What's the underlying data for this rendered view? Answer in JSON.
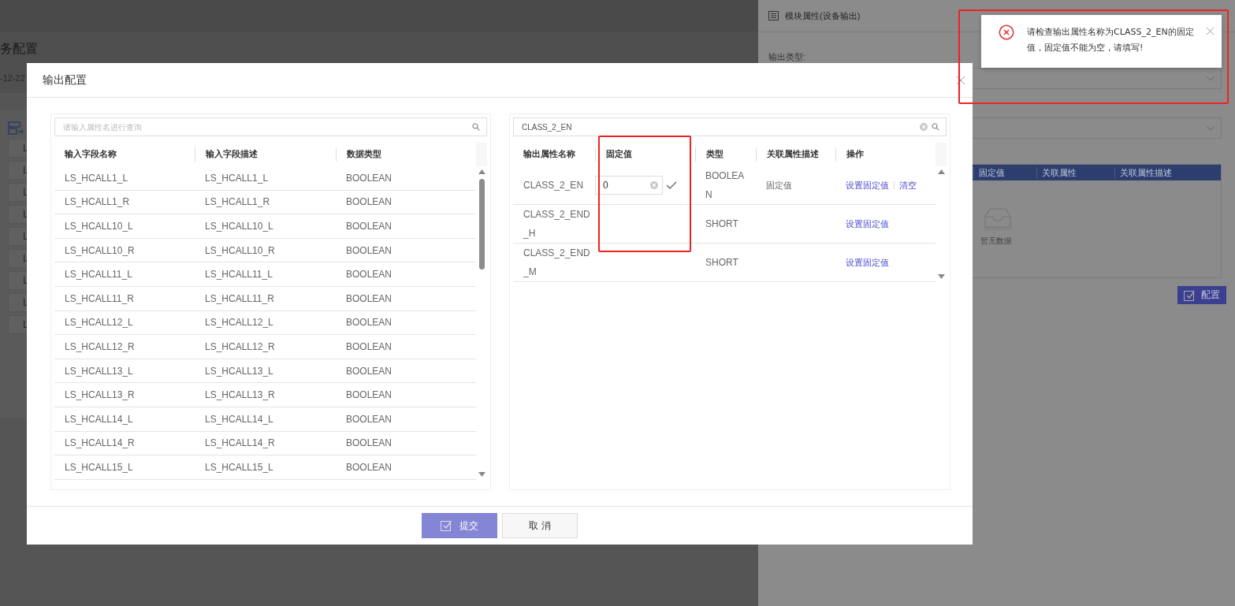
{
  "background_page": {
    "title": "务配置",
    "date": "-12-22",
    "list_items": [
      "L",
      "L",
      "L",
      "L",
      "L",
      "L",
      "L",
      "L",
      "L"
    ]
  },
  "side_panel": {
    "title": "模块属性(设备输出)",
    "output_type_label": "输出类型:",
    "table_columns": [
      "固定值",
      "关联属性",
      "关联属性描述"
    ],
    "empty_text": "暂无数据",
    "configure_button": "配置"
  },
  "dialog": {
    "title": "输出配置",
    "left": {
      "search_placeholder": "请输入属性名进行查询",
      "columns": [
        "输入字段名称",
        "输入字段描述",
        "数据类型"
      ],
      "rows": [
        [
          "LS_HCALL1_L",
          "LS_HCALL1_L",
          "BOOLEAN"
        ],
        [
          "LS_HCALL1_R",
          "LS_HCALL1_R",
          "BOOLEAN"
        ],
        [
          "LS_HCALL10_L",
          "LS_HCALL10_L",
          "BOOLEAN"
        ],
        [
          "LS_HCALL10_R",
          "LS_HCALL10_R",
          "BOOLEAN"
        ],
        [
          "LS_HCALL11_L",
          "LS_HCALL11_L",
          "BOOLEAN"
        ],
        [
          "LS_HCALL11_R",
          "LS_HCALL11_R",
          "BOOLEAN"
        ],
        [
          "LS_HCALL12_L",
          "LS_HCALL12_L",
          "BOOLEAN"
        ],
        [
          "LS_HCALL12_R",
          "LS_HCALL12_R",
          "BOOLEAN"
        ],
        [
          "LS_HCALL13_L",
          "LS_HCALL13_L",
          "BOOLEAN"
        ],
        [
          "LS_HCALL13_R",
          "LS_HCALL13_R",
          "BOOLEAN"
        ],
        [
          "LS_HCALL14_L",
          "LS_HCALL14_L",
          "BOOLEAN"
        ],
        [
          "LS_HCALL14_R",
          "LS_HCALL14_R",
          "BOOLEAN"
        ],
        [
          "LS_HCALL15_L",
          "LS_HCALL15_L",
          "BOOLEAN"
        ]
      ]
    },
    "right": {
      "search_value": "CLASS_2_EN",
      "columns": [
        "输出属性名称",
        "固定值",
        "类型",
        "关联属性描述",
        "操作"
      ],
      "rows": [
        {
          "name": "CLASS_2_EN",
          "editing": true,
          "fixed_value": "0",
          "type": "BOOLEAN",
          "description": "固定值",
          "actions": [
            "设置固定值",
            "清空"
          ]
        },
        {
          "name": "CLASS_2_END_H",
          "editing": false,
          "type": "SHORT",
          "actions": [
            "设置固定值"
          ]
        },
        {
          "name": "CLASS_2_END_M",
          "editing": false,
          "type": "SHORT",
          "actions": [
            "设置固定值"
          ]
        }
      ]
    },
    "buttons": [
      {
        "label": "提交",
        "kind": "primary"
      },
      {
        "label": "取 消",
        "kind": "default"
      }
    ]
  },
  "toast": {
    "message": "请检查输出属性名称为CLASS_2_EN的固定值，固定值不能为空，请填写!"
  }
}
